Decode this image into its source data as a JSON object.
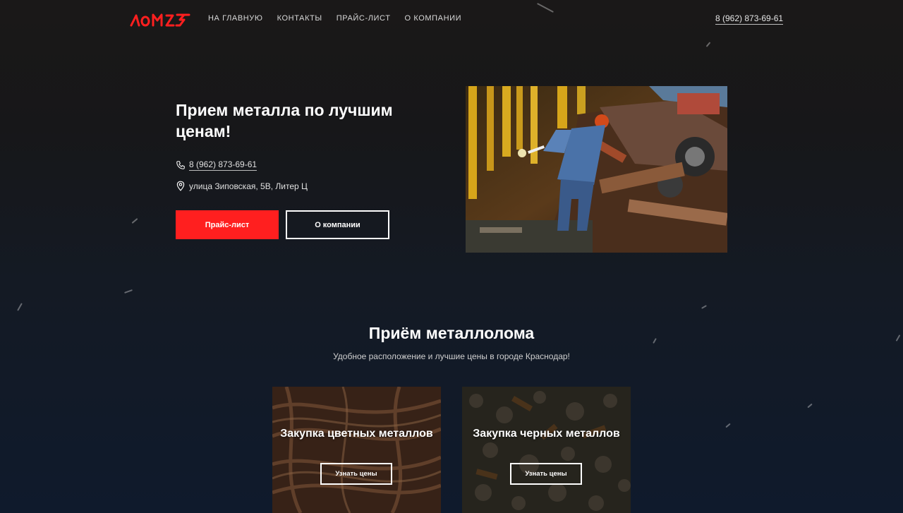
{
  "header": {
    "logo_text": "ЛОМ23",
    "nav": [
      {
        "label": "НА ГЛАВНУЮ"
      },
      {
        "label": "КОНТАКТЫ"
      },
      {
        "label": "ПРАЙС-ЛИСТ"
      },
      {
        "label": "О КОМПАНИИ"
      }
    ],
    "phone": "8 (962) 873-69-61"
  },
  "hero": {
    "title": "Прием металла по лучшим ценам!",
    "phone": "8 (962) 873-69-61",
    "address": "улица Зиповская, 5В, Литер Ц",
    "price_button": "Прайс-лист",
    "about_button": "О компании"
  },
  "section": {
    "title": "Приём металлолома",
    "subtitle": "Удобное расположение и лучшие цены в городе Краснодар!"
  },
  "cards": [
    {
      "title": "Закупка цветных металлов",
      "button": "Узнать цены"
    },
    {
      "title": "Закупка черных металлов",
      "button": "Узнать цены"
    }
  ],
  "colors": {
    "accent": "#ff1f1f",
    "background_top": "#1a1818",
    "background_bottom": "#0f1a2c"
  },
  "icons": [
    "phone-icon",
    "location-pin-icon"
  ]
}
